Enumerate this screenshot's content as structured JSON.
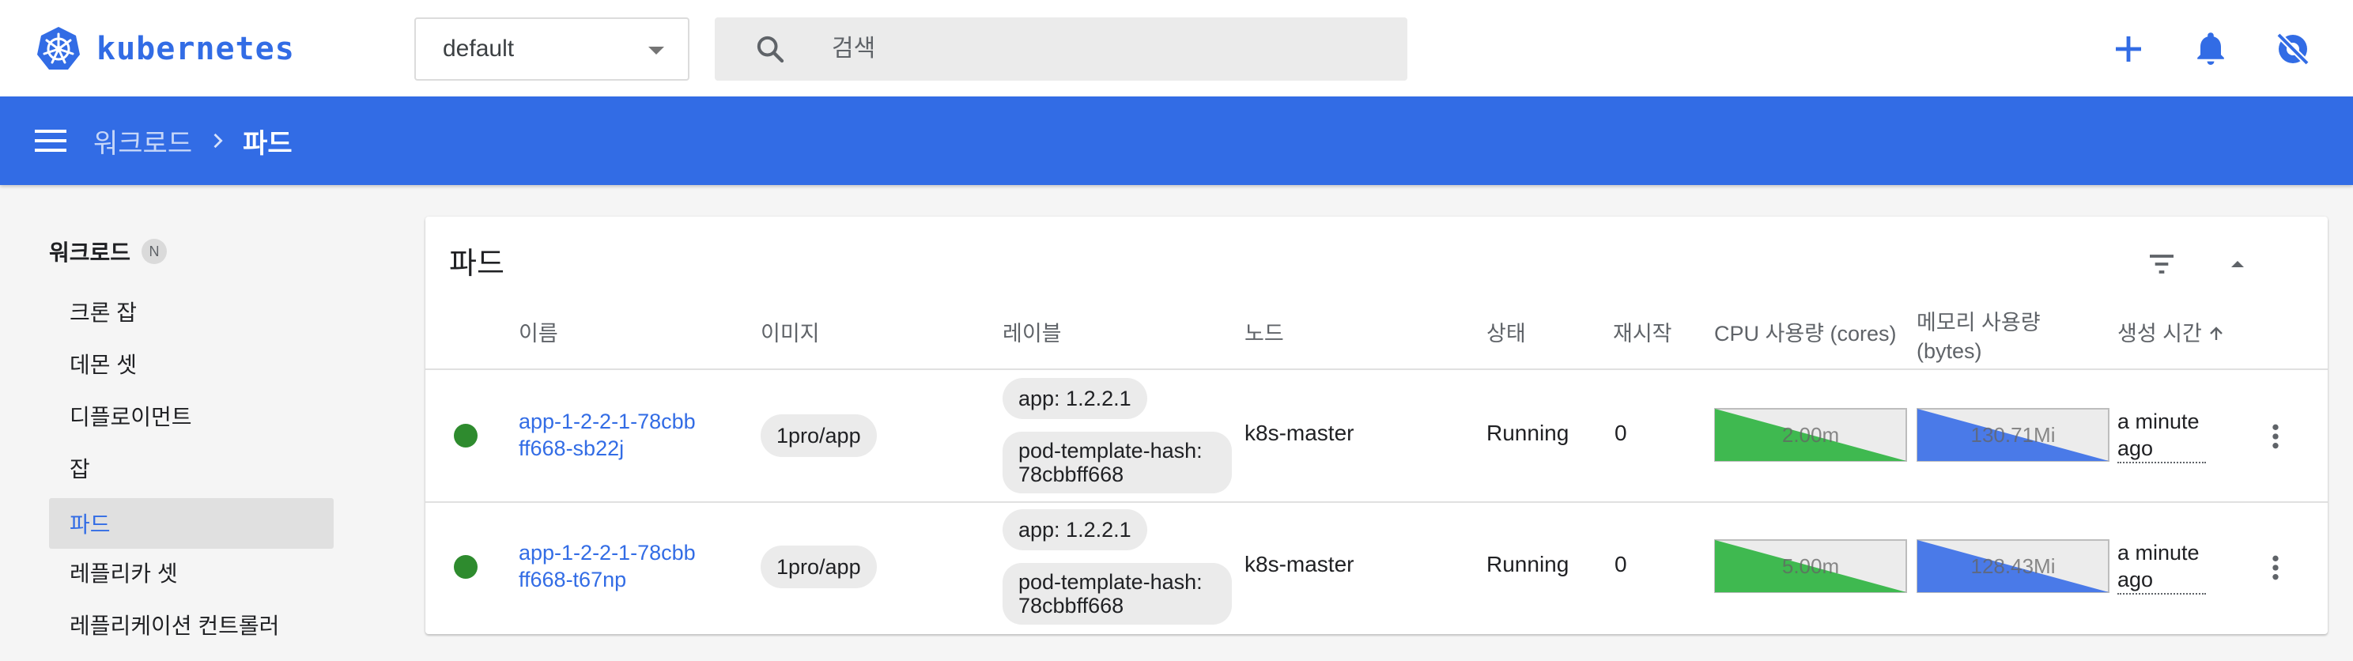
{
  "app": {
    "name": "kubernetes"
  },
  "namespace": {
    "value": "default"
  },
  "search": {
    "placeholder": "검색"
  },
  "breadcrumb": {
    "parent": "워크로드",
    "current": "파드"
  },
  "nav": {
    "section": "워크로드",
    "section_badge": "N",
    "items": [
      {
        "label": "크론 잡"
      },
      {
        "label": "데몬 셋"
      },
      {
        "label": "디플로이먼트"
      },
      {
        "label": "잡"
      },
      {
        "label": "파드"
      },
      {
        "label": "레플리카 셋"
      },
      {
        "label": "레플리케이션 컨트롤러"
      }
    ],
    "active_item": "파드"
  },
  "card": {
    "title": "파드",
    "columns": {
      "name": "이름",
      "image": "이미지",
      "labels": "레이블",
      "node": "노드",
      "status": "상태",
      "restarts": "재시작",
      "cpu": "CPU 사용량 (cores)",
      "memory_line1": "메모리 사용량",
      "memory_line2": "(bytes)",
      "created": "생성 시간"
    },
    "sort_column": "생성 시간",
    "rows": [
      {
        "name": "app-1-2-2-1-78cbbff668-sb22j",
        "image": "1pro/app",
        "label1": "app: 1.2.2.1",
        "label2": "pod-template-hash: 78cbbff668",
        "node": "k8s-master",
        "status": "Running",
        "restarts": "0",
        "cpu": "2.00m",
        "memory": "130.71Mi",
        "age": "a minute ago"
      },
      {
        "name": "app-1-2-2-1-78cbbff668-t67np",
        "image": "1pro/app",
        "label1": "app: 1.2.2.1",
        "label2": "pod-template-hash: 78cbbff668",
        "node": "k8s-master",
        "status": "Running",
        "restarts": "0",
        "cpu": "5.00m",
        "memory": "128.43Mi",
        "age": "a minute ago"
      }
    ]
  },
  "colors": {
    "brand": "#326ce5",
    "running": "#2e8b2e",
    "cpu_chart": "#3fb950",
    "memory_chart": "#4a7ae8"
  },
  "icons": [
    "kubernetes-logo-icon",
    "search-icon",
    "add-icon",
    "bell-icon",
    "settings-off-icon",
    "menu-icon",
    "chevron-right-icon",
    "filter-icon",
    "chevron-up-icon",
    "arrow-up-icon",
    "more-vert-icon"
  ]
}
